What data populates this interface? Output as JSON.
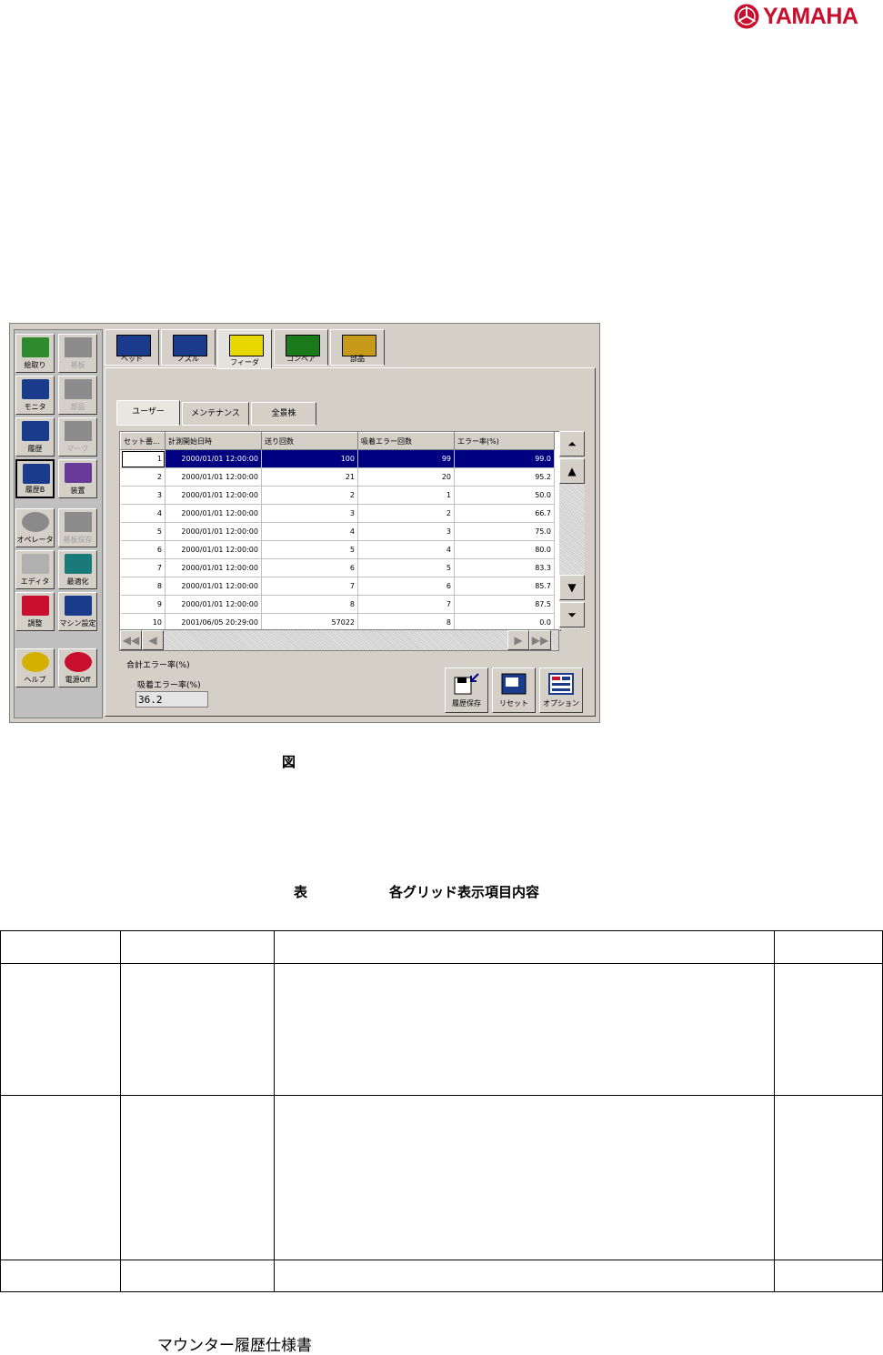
{
  "logo": {
    "brand": "YAMAHA",
    "color": "#c8102e"
  },
  "screen": {
    "side_buttons": [
      {
        "label": "絵取り",
        "icon": "pickup-icon",
        "disabled": false
      },
      {
        "label": "基板",
        "icon": "board-icon",
        "disabled": true
      },
      {
        "label": "モニタ",
        "icon": "monitor-icon",
        "disabled": false
      },
      {
        "label": "部品",
        "icon": "parts-icon",
        "disabled": true
      },
      {
        "label": "履歴",
        "icon": "history-icon",
        "disabled": false
      },
      {
        "label": "マーク",
        "icon": "mark-icon",
        "disabled": true
      },
      {
        "label": "履歴B",
        "icon": "history-b-icon",
        "disabled": false
      },
      {
        "label": "装置",
        "icon": "machine-icon",
        "disabled": false
      },
      {
        "label": "オペレータ",
        "icon": "operator-icon",
        "disabled": false
      },
      {
        "label": "基板保存",
        "icon": "save-board-icon",
        "disabled": true
      },
      {
        "label": "エディタ",
        "icon": "editor-icon",
        "disabled": false
      },
      {
        "label": "最適化",
        "icon": "optimize-icon",
        "disabled": false
      },
      {
        "label": "調整",
        "icon": "wrench-icon",
        "disabled": false
      },
      {
        "label": "マシン設定",
        "icon": "machine-settings-icon",
        "disabled": false
      },
      {
        "label": "ヘルプ",
        "icon": "help-icon",
        "disabled": false
      },
      {
        "label": "電源Off",
        "icon": "power-icon",
        "disabled": false
      }
    ],
    "top_tabs": [
      "ヘッド",
      "ノズル",
      "フィーダ",
      "コンベア",
      "部品"
    ],
    "active_top_tab": 2,
    "sub_tabs": [
      "ユーザー",
      "メンテナンス",
      "全景株"
    ],
    "grid": {
      "headers": [
        "セット番...",
        "計測開始日時",
        "送り回数",
        "吸着エラー回数",
        "エラー率(%)"
      ],
      "rows": [
        [
          "1",
          "2000/01/01 12:00:00",
          "100",
          "99",
          "99.0"
        ],
        [
          "2",
          "2000/01/01 12:00:00",
          "21",
          "20",
          "95.2"
        ],
        [
          "3",
          "2000/01/01 12:00:00",
          "2",
          "1",
          "50.0"
        ],
        [
          "4",
          "2000/01/01 12:00:00",
          "3",
          "2",
          "66.7"
        ],
        [
          "5",
          "2000/01/01 12:00:00",
          "4",
          "3",
          "75.0"
        ],
        [
          "6",
          "2000/01/01 12:00:00",
          "5",
          "4",
          "80.0"
        ],
        [
          "7",
          "2000/01/01 12:00:00",
          "6",
          "5",
          "83.3"
        ],
        [
          "8",
          "2000/01/01 12:00:00",
          "7",
          "6",
          "85.7"
        ],
        [
          "9",
          "2000/01/01 12:00:00",
          "8",
          "7",
          "87.5"
        ],
        [
          "10",
          "2001/06/05 20:29:00",
          "57022",
          "8",
          "0.0"
        ]
      ]
    },
    "total_error_label": "合計エラー率(%)",
    "suction_error_label": "吸着エラー率(%)",
    "suction_error_value": "36.2",
    "action_buttons": [
      {
        "label": "履歴保存",
        "icon": "save-history-icon"
      },
      {
        "label": "リセット",
        "icon": "reset-icon"
      },
      {
        "label": "オプション",
        "icon": "options-icon"
      }
    ]
  },
  "figure_caption": "図",
  "table_caption": {
    "prefix": "表",
    "title": "各グリッド表示項目内容"
  },
  "footer": "マウンター履歴仕様書"
}
